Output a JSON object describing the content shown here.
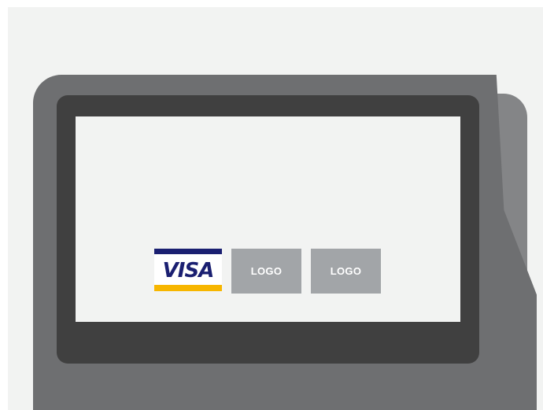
{
  "payment_terminal": {
    "screen": {
      "brand_logos": [
        {
          "name": "VISA",
          "type": "card-brand",
          "colors": {
            "primary": "#1a1f71",
            "accent": "#f7b600"
          }
        },
        {
          "name": "LOGO",
          "type": "placeholder"
        },
        {
          "name": "LOGO",
          "type": "placeholder"
        }
      ]
    }
  },
  "colors": {
    "background": "#f2f3f2",
    "device_body": "#6e6f71",
    "device_side": "#848587",
    "bezel": "#404040",
    "placeholder_tile": "#a2a5a8"
  }
}
